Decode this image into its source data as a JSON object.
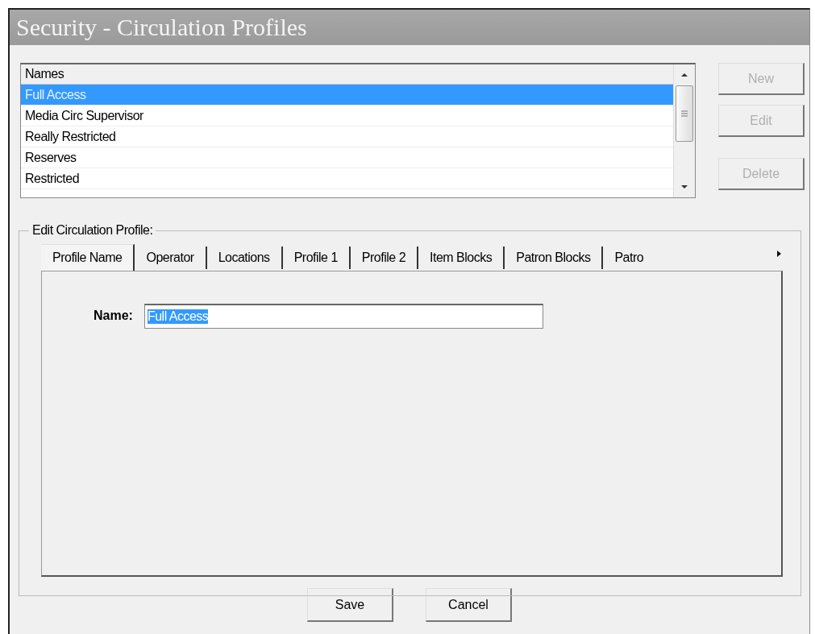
{
  "window": {
    "title": "Security - Circulation Profiles"
  },
  "names_list": {
    "header": "Names",
    "items": [
      {
        "label": "Full Access",
        "selected": true
      },
      {
        "label": "Media Circ Supervisor",
        "selected": false
      },
      {
        "label": "Really Restricted",
        "selected": false
      },
      {
        "label": "Reserves",
        "selected": false
      },
      {
        "label": "Restricted",
        "selected": false
      }
    ]
  },
  "side_buttons": [
    {
      "label": "New",
      "disabled": true
    },
    {
      "label": "Edit",
      "disabled": true
    },
    {
      "label": "Delete",
      "disabled": true
    }
  ],
  "edit_group": {
    "title": "Edit Circulation Profile:",
    "tabs": [
      {
        "label": "Profile Name",
        "selected": true
      },
      {
        "label": "Operator",
        "selected": false
      },
      {
        "label": "Locations",
        "selected": false
      },
      {
        "label": "Profile 1",
        "selected": false
      },
      {
        "label": "Profile 2",
        "selected": false
      },
      {
        "label": "Item Blocks",
        "selected": false
      },
      {
        "label": "Patron Blocks",
        "selected": false
      },
      {
        "label": "Patro",
        "selected": false
      }
    ],
    "name_field": {
      "label": "Name:",
      "value": "Full Access"
    }
  },
  "buttons": [
    {
      "label": "Save"
    },
    {
      "label": "Cancel"
    }
  ]
}
